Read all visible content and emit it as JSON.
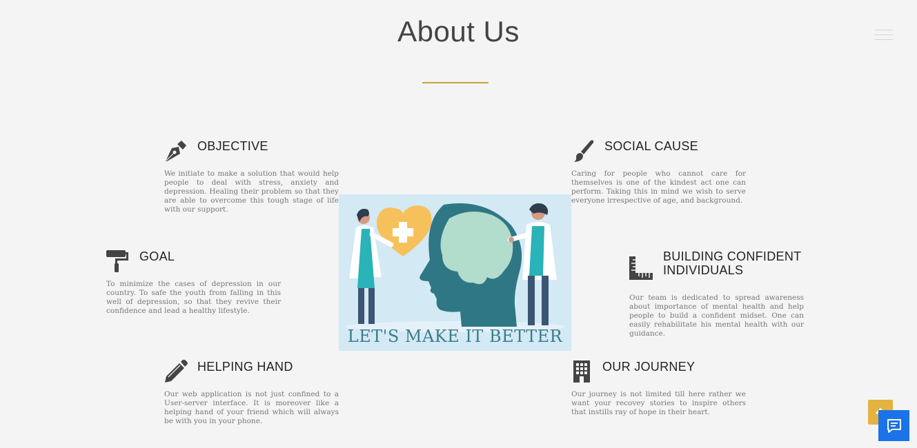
{
  "page": {
    "title": "About Us"
  },
  "colors": {
    "accent": "#c9a13c",
    "icon": "#444444",
    "chat": "#1a73e8",
    "scroll_top": "#e4b23f"
  },
  "sections": {
    "objective": {
      "icon": "fountain-pen-icon",
      "heading": "OBJECTIVE",
      "text": "We initiate to make a solution that would help people to deal with stress, anxiety and depression. Healing their problem so that they are able to overcome this tough stage of life with our support."
    },
    "social_cause": {
      "icon": "paint-brush-icon",
      "heading": "SOCIAL CAUSE",
      "text": "Caring for people who cannot care for themselves is one of the kindest act one can perform. Taking this in mind we wish to serve everyone irrespective of age, and background."
    },
    "goal": {
      "icon": "paint-roller-icon",
      "heading": "GOAL",
      "text": "To minimize the cases of depression in our country. To safe the youth from falling in this well of depression, so that they revive their confidence and lead a healthy lifestyle."
    },
    "building": {
      "icon": "ruler-combined-icon",
      "heading": "BUILDING CONFIDENT INDIVIDUALS",
      "text": "Our team is dedicated to spread awareness about importance of mental health and help people to build a confident midset. One can easily rehabilitate his mental health with our guidance."
    },
    "helping_hand": {
      "icon": "pencil-icon",
      "heading": "HELPING HAND",
      "text": "Our web application is not just confined to a User-server interface. It is moreover like a helping hand of your friend which will always be with you in your phone."
    },
    "journey": {
      "icon": "building-icon",
      "heading": "OUR JOURNEY",
      "text": "Our journey is not limited till here rather we want your recovey stories to inspire others that instills ray of hope in their heart."
    }
  },
  "illustration": {
    "caption": "LET'S MAKE IT BETTER"
  }
}
